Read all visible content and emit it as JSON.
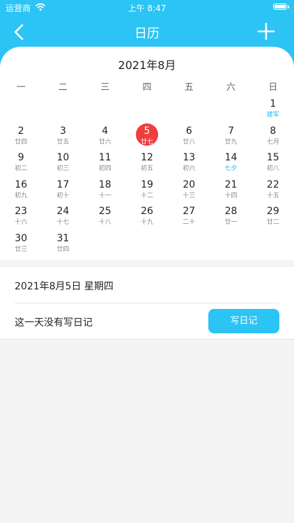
{
  "status_bar": {
    "carrier": "运营商",
    "time": "上午 8:47"
  },
  "nav": {
    "title": "日历"
  },
  "calendar": {
    "month_title": "2021年8月",
    "weekdays": [
      "一",
      "二",
      "三",
      "四",
      "五",
      "六",
      "日"
    ],
    "leading_blanks": 6,
    "selected_day": "5",
    "days": [
      {
        "day": "1",
        "lunar": "建军",
        "festival": true
      },
      {
        "day": "2",
        "lunar": "廿四"
      },
      {
        "day": "3",
        "lunar": "廿五"
      },
      {
        "day": "4",
        "lunar": "廿六"
      },
      {
        "day": "5",
        "lunar": "廿七"
      },
      {
        "day": "6",
        "lunar": "廿八"
      },
      {
        "day": "7",
        "lunar": "廿九"
      },
      {
        "day": "8",
        "lunar": "七月"
      },
      {
        "day": "9",
        "lunar": "初二"
      },
      {
        "day": "10",
        "lunar": "初三"
      },
      {
        "day": "11",
        "lunar": "初四"
      },
      {
        "day": "12",
        "lunar": "初五"
      },
      {
        "day": "13",
        "lunar": "初六"
      },
      {
        "day": "14",
        "lunar": "七夕",
        "festival": true
      },
      {
        "day": "15",
        "lunar": "初八"
      },
      {
        "day": "16",
        "lunar": "初九"
      },
      {
        "day": "17",
        "lunar": "初十"
      },
      {
        "day": "18",
        "lunar": "十一"
      },
      {
        "day": "19",
        "lunar": "十二"
      },
      {
        "day": "20",
        "lunar": "十三"
      },
      {
        "day": "21",
        "lunar": "十四"
      },
      {
        "day": "22",
        "lunar": "十五"
      },
      {
        "day": "23",
        "lunar": "十六"
      },
      {
        "day": "24",
        "lunar": "十七"
      },
      {
        "day": "25",
        "lunar": "十八"
      },
      {
        "day": "26",
        "lunar": "十九"
      },
      {
        "day": "27",
        "lunar": "二十"
      },
      {
        "day": "28",
        "lunar": "廿一"
      },
      {
        "day": "29",
        "lunar": "廿二"
      },
      {
        "day": "30",
        "lunar": "廿三"
      },
      {
        "day": "31",
        "lunar": "廿四"
      }
    ]
  },
  "detail": {
    "date_line": "2021年8月5日  星期四",
    "empty_text": "这一天没有写日记",
    "write_button": "写日记"
  },
  "colors": {
    "accent": "#2bc4f4",
    "selected": "#f03e3e",
    "festival": "#2bb8e8"
  },
  "icons": {
    "back": "chevron-left-icon",
    "add": "plus-icon",
    "wifi": "wifi-icon",
    "battery": "battery-icon"
  }
}
